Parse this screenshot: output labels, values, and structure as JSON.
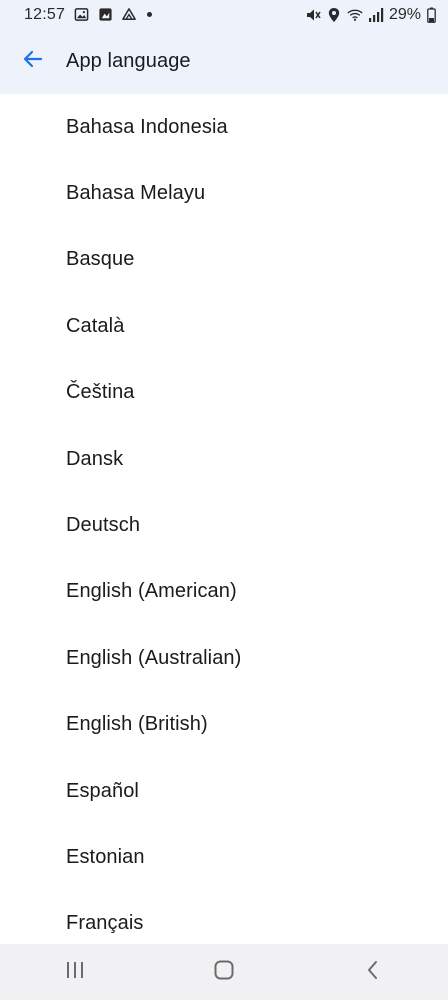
{
  "status_bar": {
    "time": "12:57",
    "battery": "29%",
    "icons_left": [
      "gallery-icon",
      "photos-icon",
      "drive-icon",
      "notification-dot"
    ],
    "icons_right": [
      "mute-icon",
      "location-icon",
      "wifi-icon",
      "signal-icon",
      "battery-icon"
    ]
  },
  "app_bar": {
    "title": "App language",
    "back_icon": "arrow-left-icon",
    "accent_color": "#1a73e8",
    "background_color": "#eef3fb"
  },
  "languages": [
    "Bahasa Indonesia",
    "Bahasa Melayu",
    "Basque",
    "Català",
    "Čeština",
    "Dansk",
    "Deutsch",
    "English (American)",
    "English (Australian)",
    "English (British)",
    "Español",
    "Estonian",
    "Français"
  ],
  "nav_bar": {
    "buttons": [
      "recents-icon",
      "home-icon",
      "back-icon"
    ]
  }
}
